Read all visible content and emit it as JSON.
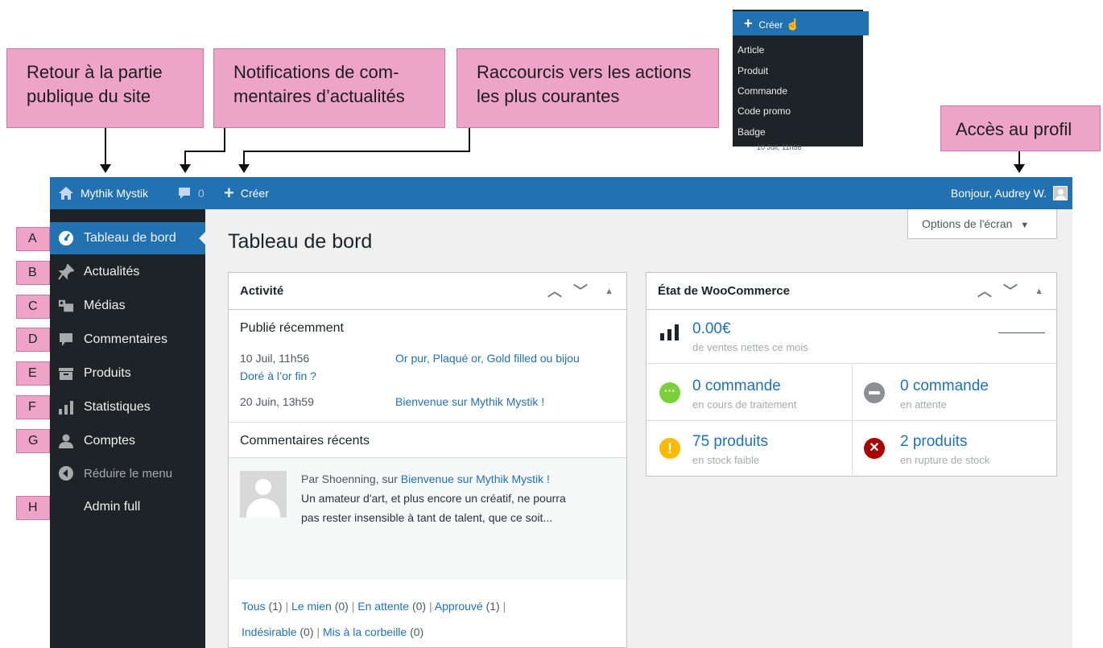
{
  "callouts": {
    "public": {
      "line1": "Retour à la partie",
      "line2": "publique du site"
    },
    "notifications": {
      "line1": "Notifications de com-",
      "line2": "mentaires d’actualités"
    },
    "shortcuts": {
      "line1": "Raccourcis vers les actions",
      "line2": "les plus courantes"
    },
    "profile": {
      "line1": "Accès au profil"
    }
  },
  "dropdown": {
    "header": "Créer",
    "items": [
      "Article",
      "Produit",
      "Commande",
      "Code promo",
      "Badge"
    ],
    "behind_timestamp": "10 Juil, 11h56"
  },
  "adminbar": {
    "site_name": "Mythik Mystik",
    "comment_count": "0",
    "create_label": "Créer",
    "greeting": "Bonjour, Audrey W."
  },
  "sidebar": {
    "items": [
      {
        "tag": "A",
        "label": "Tableau de bord",
        "icon": "dashboard-icon"
      },
      {
        "tag": "B",
        "label": "Actualités",
        "icon": "pin-icon"
      },
      {
        "tag": "C",
        "label": "Médias",
        "icon": "media-icon"
      },
      {
        "tag": "D",
        "label": "Commentaires",
        "icon": "comment-icon"
      },
      {
        "tag": "E",
        "label": "Produits",
        "icon": "products-icon"
      },
      {
        "tag": "F",
        "label": "Statistiques",
        "icon": "stats-icon"
      },
      {
        "tag": "G",
        "label": "Comptes",
        "icon": "user-icon"
      }
    ],
    "collapse_label": "Réduire le menu",
    "admin_tag": "H",
    "admin_label": "Admin full"
  },
  "main": {
    "page_title": "Tableau de bord",
    "screen_options": "Options de l'écran",
    "activity": {
      "title": "Activité",
      "recent_heading": "Publié récemment",
      "posts": [
        {
          "date": "10 Juil, 11h56",
          "title": "Or pur, Plaqué or, Gold filled ou bijou",
          "title_cont": "Doré à l’or fin ?"
        },
        {
          "date": "20 Juin, 13h59",
          "title": "Bienvenue sur Mythik Mystik !"
        }
      ],
      "comments_heading": "Commentaires récents",
      "comment": {
        "by": "Par Shoenning, sur ",
        "post": "Bienvenue sur Mythik Mystik !",
        "line1": "Un amateur d'art, et plus encore un créatif, ne pourra",
        "line2": "pas rester insensible à tant de talent, que ce soit..."
      },
      "filters": {
        "all": "Tous",
        "all_n": "(1)",
        "mine": "Le mien",
        "mine_n": "(0)",
        "pending": "En attente",
        "pending_n": "(0)",
        "approved": "Approuvé",
        "approved_n": "(1)",
        "spam": "Indésirable",
        "spam_n": "(0)",
        "trash": "Mis à la corbeille",
        "trash_n": "(0)"
      }
    },
    "woo": {
      "title": "État de WooCommerce",
      "sales_value": "0.00€",
      "sales_label": "de ventes nettes ce mois",
      "processing_value": "0 commande",
      "processing_label": "en cours de traitement",
      "onhold_value": "0 commande",
      "onhold_label": "en attente",
      "lowstock_value": "75 produits",
      "lowstock_label": "en stock faible",
      "outstock_value": "2 produits",
      "outstock_label": "en rupture de stock"
    }
  },
  "colors": {
    "admin_blue": "#2271b1",
    "sidebar_dark": "#1d2327",
    "callout_pink": "#eea3c9",
    "link_blue": "#2271b1"
  }
}
